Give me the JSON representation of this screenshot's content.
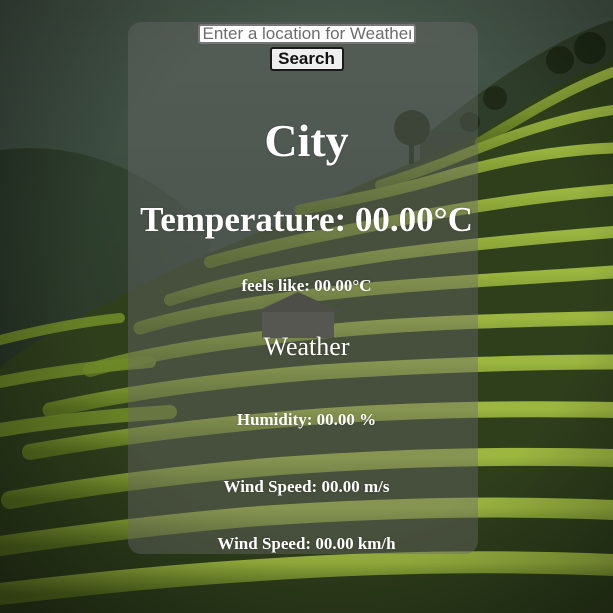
{
  "search": {
    "placeholder": "Enter a location for Weather",
    "value": "",
    "button_label": "Search"
  },
  "weather": {
    "city": "City",
    "temperature": "Temperature: 00.00°C",
    "feels_like": "feels like: 00.00°C",
    "description": "Weather",
    "humidity": "Humidity: 00.00 %",
    "wind_speed_ms": "Wind Speed: 00.00 m/s",
    "wind_speed_kmh": "Wind Speed: 00.00 km/h"
  },
  "colors": {
    "card_background": "#696969",
    "text": "#ffffff",
    "terrace_green": "#7c9a2c",
    "mist": "#3c4b41"
  }
}
